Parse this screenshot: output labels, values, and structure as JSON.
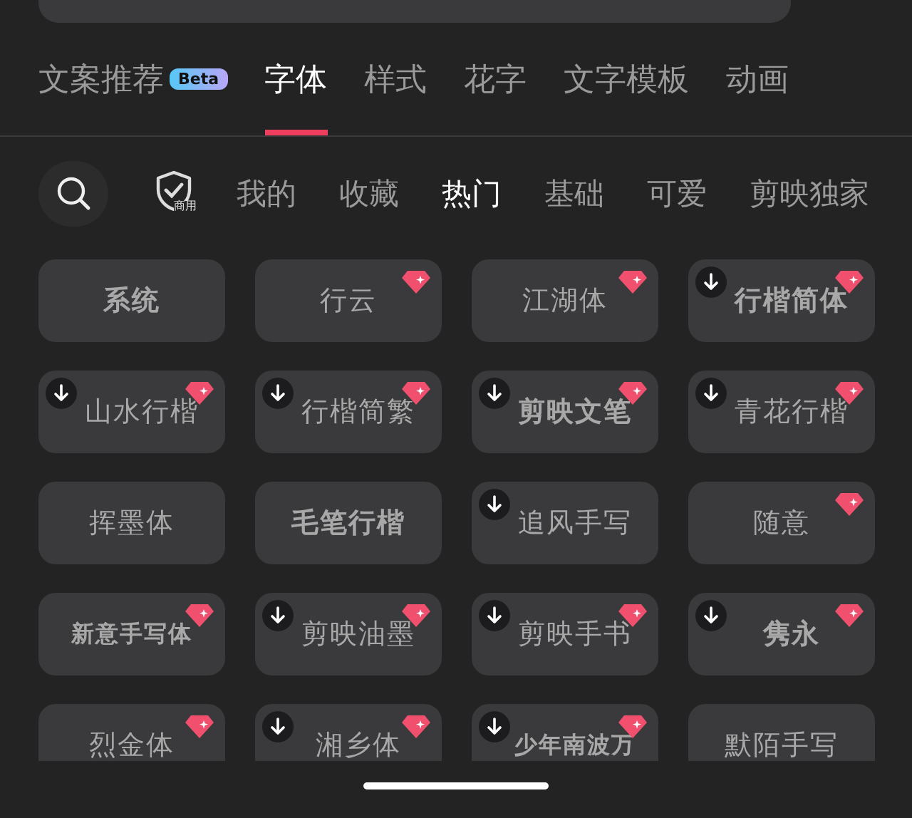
{
  "tabs": [
    {
      "label": "文案推荐",
      "badge": "Beta",
      "selected": false
    },
    {
      "label": "字体",
      "selected": true
    },
    {
      "label": "样式",
      "selected": false
    },
    {
      "label": "花字",
      "selected": false
    },
    {
      "label": "文字模板",
      "selected": false
    },
    {
      "label": "动画",
      "selected": false
    }
  ],
  "filter": {
    "commercial_label": "商用",
    "categories": [
      {
        "label": "我的",
        "selected": false
      },
      {
        "label": "收藏",
        "selected": false
      },
      {
        "label": "热门",
        "selected": true
      },
      {
        "label": "基础",
        "selected": false
      },
      {
        "label": "可爱",
        "selected": false
      },
      {
        "label": "剪映独家",
        "selected": false
      }
    ]
  },
  "fonts": [
    {
      "name": "系统",
      "premium": false,
      "download": false
    },
    {
      "name": "行云",
      "premium": true,
      "download": false
    },
    {
      "name": "江湖体",
      "premium": true,
      "download": false
    },
    {
      "name": "行楷简体",
      "premium": true,
      "download": true
    },
    {
      "name": "山水行楷",
      "premium": true,
      "download": true
    },
    {
      "name": "行楷简繁",
      "premium": true,
      "download": true
    },
    {
      "name": "剪映文笔",
      "premium": true,
      "download": true
    },
    {
      "name": "青花行楷",
      "premium": true,
      "download": true
    },
    {
      "name": "挥墨体",
      "premium": false,
      "download": false
    },
    {
      "name": "毛笔行楷",
      "premium": false,
      "download": false
    },
    {
      "name": "追风手写",
      "premium": false,
      "download": true
    },
    {
      "name": "随意",
      "premium": true,
      "download": false
    },
    {
      "name": "新意手写体",
      "premium": true,
      "download": false
    },
    {
      "name": "剪映油墨",
      "premium": true,
      "download": true
    },
    {
      "name": "剪映手书",
      "premium": true,
      "download": true
    },
    {
      "name": "隽永",
      "premium": true,
      "download": true
    },
    {
      "name": "烈金体",
      "premium": true,
      "download": false
    },
    {
      "name": "湘乡体",
      "premium": true,
      "download": true
    },
    {
      "name": "少年南波万",
      "premium": true,
      "download": true
    },
    {
      "name": "默陌手写",
      "premium": false,
      "download": false
    }
  ]
}
